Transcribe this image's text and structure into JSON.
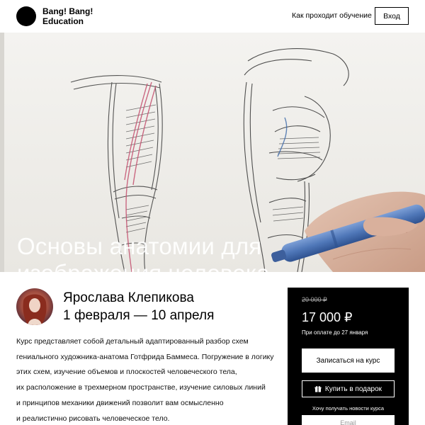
{
  "header": {
    "logo_text": "Bang! Bang!\nEducation",
    "nav_link": "Как проходит обучение",
    "login_label": "Вход"
  },
  "hero": {
    "title": "Основы анатомии для изображения человека"
  },
  "instructor": {
    "name": "Ярослава Клепикова",
    "dates": "1 февраля — 10 апреля"
  },
  "description": {
    "lines": [
      "Курс представляет собой детальный адаптированный разбор схем",
      "гениального художника-анатома Готфрида Баммеса. Погружение в логику",
      "этих схем, изучение объемов и плоскостей человеческого тела,",
      "их расположение в трехмерном пространстве, изучение силовых линий",
      "и принципов механики движений позволит вам осмысленно",
      "и реалистично рисовать человеческое тело."
    ]
  },
  "pricing": {
    "old_price": "20 000 ₽",
    "price": "17 000 ₽",
    "note": "При оплате до 27 января",
    "enroll_label": "Записаться на курс",
    "gift_label": "Купить в подарок",
    "newsletter_label": "Хочу получать новости курса",
    "email_placeholder": "Email"
  },
  "colors": {
    "panel_bg": "#000000",
    "page_bg": "#ffffff"
  },
  "icons": [
    "gift-icon"
  ]
}
